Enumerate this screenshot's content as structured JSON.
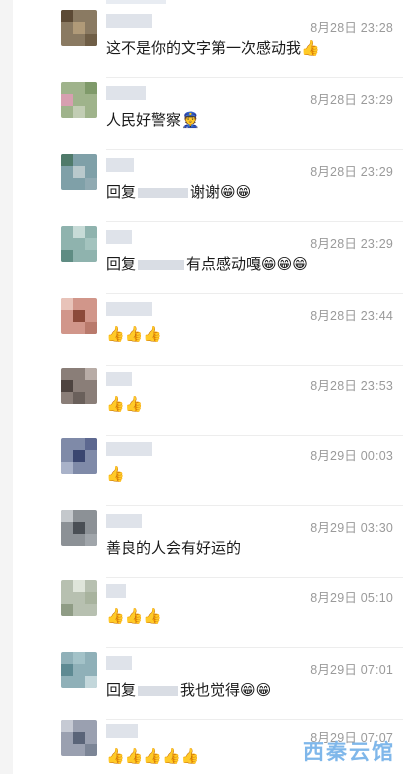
{
  "comments": [
    {
      "time": "8月28日 23:28",
      "parts": [
        "这不是你的文字第一次感动我👍"
      ]
    },
    {
      "time": "8月28日 23:29",
      "parts": [
        "人民好警察👮"
      ]
    },
    {
      "time": "8月28日 23:29",
      "parts": [
        "回复",
        "谢谢😁😁"
      ]
    },
    {
      "time": "8月28日 23:29",
      "parts": [
        "回复",
        "有点感动嘎😁😁😁"
      ]
    },
    {
      "time": "8月28日 23:44",
      "parts": [
        "👍👍👍"
      ]
    },
    {
      "time": "8月28日 23:53",
      "parts": [
        "👍👍"
      ]
    },
    {
      "time": "8月29日 00:03",
      "parts": [
        "👍"
      ]
    },
    {
      "time": "8月29日 03:30",
      "parts": [
        "善良的人会有好运的"
      ]
    },
    {
      "time": "8月29日 05:10",
      "parts": [
        "👍👍👍"
      ]
    },
    {
      "time": "8月29日 07:01",
      "parts": [
        "回复",
        "我也觉得😁😁"
      ]
    },
    {
      "time": "8月29日 07:07",
      "parts": [
        "👍👍👍👍👍"
      ]
    }
  ],
  "watermark": "西秦云馆",
  "colors": {
    "time": "#9a9a9a",
    "text": "#1a1a1a",
    "watermark": "#7fb7ea",
    "blur": "#d9dde4"
  }
}
